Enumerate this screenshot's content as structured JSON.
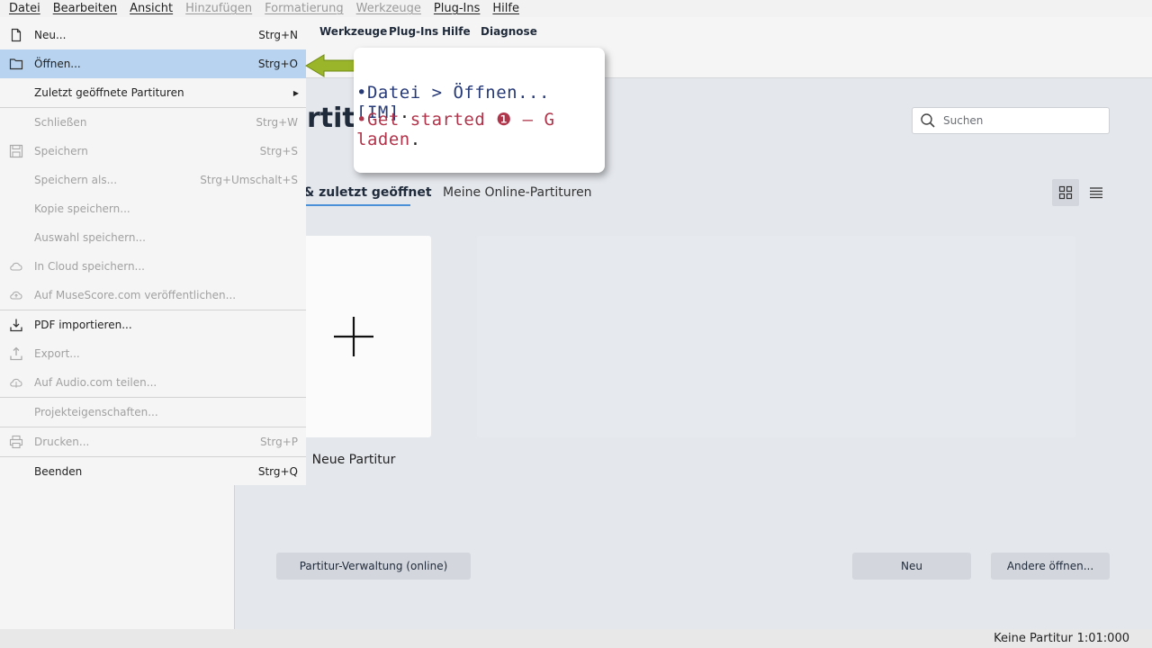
{
  "os_menubar": {
    "items": [
      {
        "label": "Datei",
        "disabled": false
      },
      {
        "label": "Bearbeiten",
        "disabled": false
      },
      {
        "label": "Ansicht",
        "disabled": false
      },
      {
        "label": "Hinzufügen",
        "disabled": true
      },
      {
        "label": "Formatierung",
        "disabled": true
      },
      {
        "label": "Werkzeuge",
        "disabled": true
      },
      {
        "label": "Plug-Ins",
        "disabled": false
      },
      {
        "label": "Hilfe",
        "disabled": false
      }
    ]
  },
  "app_menubar": {
    "items": [
      "Werkzeuge",
      "Plug-Ins",
      "Hilfe",
      "Diagnose"
    ]
  },
  "home": {
    "heading_fragment": "rtit",
    "search_placeholder": "Suchen",
    "tabs": [
      "& zuletzt geöffnet",
      "Meine Online-Partituren"
    ],
    "new_score_label": "Neue Partitur",
    "buttons": {
      "online": "Partitur-Verwaltung (online)",
      "new": "Neu",
      "open_other": "Andere öffnen..."
    }
  },
  "file_menu": {
    "items": [
      {
        "label": "Neu...",
        "shortcut": "Strg+N",
        "icon": "new-file-icon",
        "disabled": false
      },
      {
        "label": "Öffnen...",
        "shortcut": "Strg+O",
        "icon": "folder-icon",
        "disabled": false,
        "highlighted": true
      },
      {
        "label": "Zuletzt geöffnete Partituren",
        "shortcut": "",
        "icon": "",
        "disabled": false,
        "submenu": true
      },
      {
        "label": "Schließen",
        "shortcut": "Strg+W",
        "icon": "",
        "disabled": true
      },
      {
        "label": "Speichern",
        "shortcut": "Strg+S",
        "icon": "save-icon",
        "disabled": true
      },
      {
        "label": "Speichern als...",
        "shortcut": "Strg+Umschalt+S",
        "icon": "",
        "disabled": true
      },
      {
        "label": "Kopie speichern...",
        "shortcut": "",
        "icon": "",
        "disabled": true
      },
      {
        "label": "Auswahl speichern...",
        "shortcut": "",
        "icon": "",
        "disabled": true
      },
      {
        "label": "In Cloud speichern...",
        "shortcut": "",
        "icon": "cloud-icon",
        "disabled": true
      },
      {
        "label": "Auf MuseScore.com veröffentlichen...",
        "shortcut": "",
        "icon": "cloud-upload-icon",
        "disabled": true
      },
      {
        "label": "PDF importieren...",
        "shortcut": "",
        "icon": "import-icon",
        "disabled": false
      },
      {
        "label": "Export...",
        "shortcut": "",
        "icon": "export-icon",
        "disabled": true
      },
      {
        "label": "Auf Audio.com teilen...",
        "shortcut": "",
        "icon": "cloud-share-icon",
        "disabled": true
      },
      {
        "label": "Projekteigenschaften...",
        "shortcut": "",
        "icon": "",
        "disabled": true
      },
      {
        "label": "Drucken...",
        "shortcut": "Strg+P",
        "icon": "printer-icon",
        "disabled": true
      },
      {
        "label": "Beenden",
        "shortcut": "Strg+Q",
        "icon": "",
        "disabled": false
      }
    ]
  },
  "annotation": {
    "line1_a": "•Datei > Öffnen... [IM]",
    "line1_end": ".",
    "line2_a": "•Get started ❶ — G laden",
    "line2_end": "."
  },
  "statusbar": {
    "score": "Keine Partitur",
    "time": "1:01:000"
  },
  "colors": {
    "highlight": "#b7d3ef",
    "accent_blue": "#4a90d9",
    "arrow_green": "#9bb52a",
    "note_blue": "#273a78",
    "note_red": "#b0344a"
  }
}
